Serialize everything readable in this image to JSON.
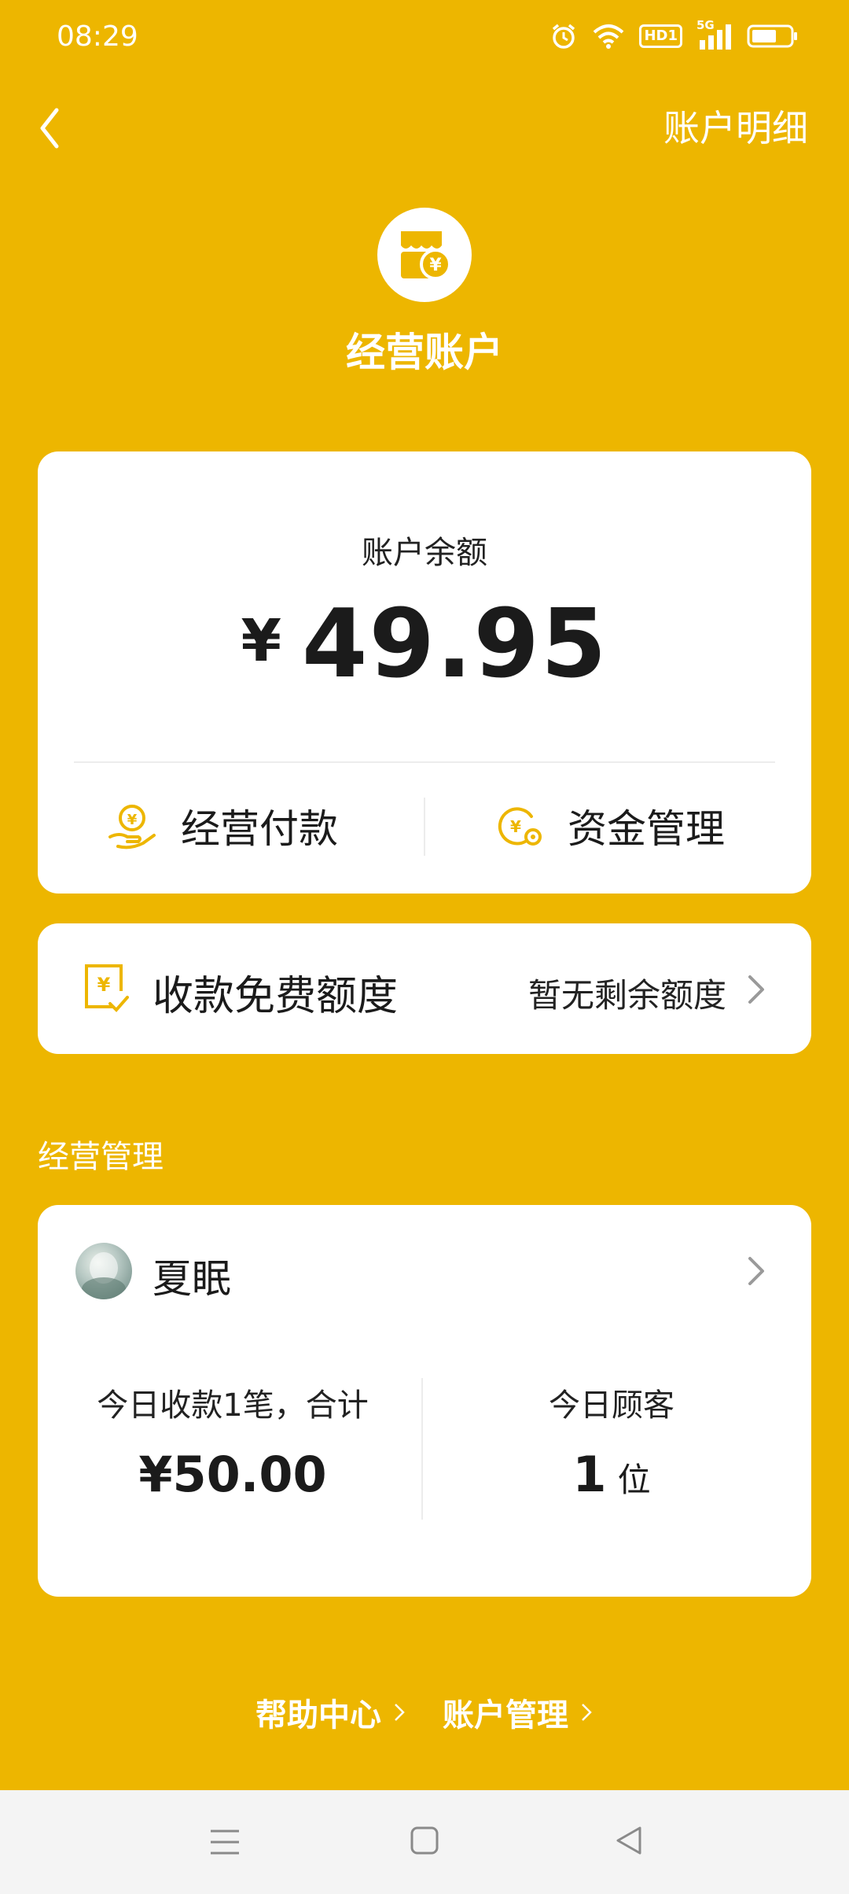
{
  "status_bar": {
    "time": "08:29",
    "signal_label": "5G",
    "hd_label": "HD1"
  },
  "nav": {
    "action": "账户明细"
  },
  "hero": {
    "title": "经营账户",
    "currency_symbol": "¥"
  },
  "balance": {
    "label": "账户余额",
    "currency": "¥",
    "amount": "49.95",
    "actions": [
      {
        "label": "经营付款",
        "icon": "hand-coin-icon"
      },
      {
        "label": "资金管理",
        "icon": "coin-gear-icon"
      }
    ]
  },
  "quota": {
    "title": "收款免费额度",
    "status": "暂无剩余额度",
    "icon": "receipt-check-icon"
  },
  "section": {
    "title": "经营管理"
  },
  "business": {
    "shop_name": "夏眠",
    "stats": [
      {
        "label": "今日收款1笔，合计",
        "value": "¥50.00",
        "unit": ""
      },
      {
        "label": "今日顾客",
        "value": "1",
        "unit": "位"
      }
    ]
  },
  "footer": {
    "links": [
      "帮助中心",
      "账户管理"
    ]
  },
  "accent_color": "#EDB600"
}
